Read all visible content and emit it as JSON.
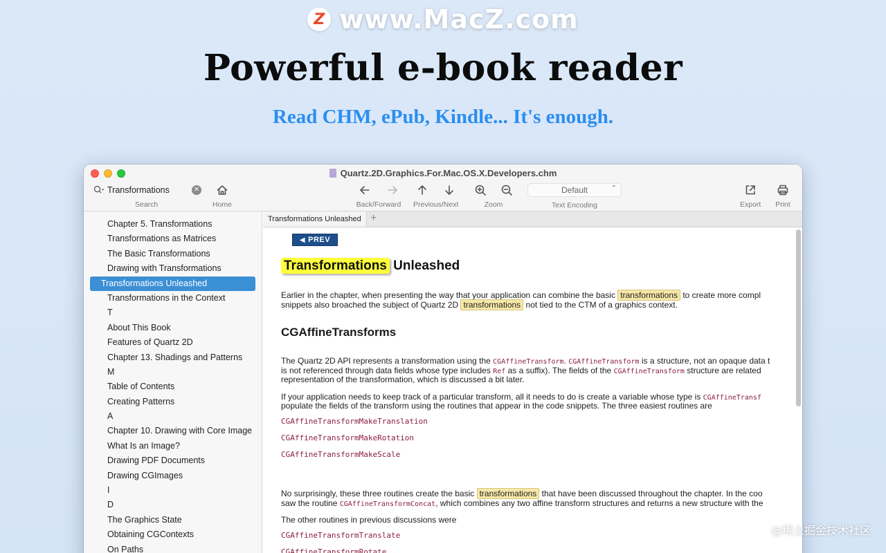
{
  "brand": {
    "logo_letter": "Z",
    "site": "www.MacZ.com"
  },
  "headline": "Powerful e-book reader",
  "subhead": "Read CHM, ePub, Kindle...  It's enough.",
  "window": {
    "title": "Quartz.2D.Graphics.For.Mac.OS.X.Developers.chm",
    "toolbar": {
      "search_value": "Transformations",
      "search_label": "Search",
      "home_label": "Home",
      "backforward_label": "Back/Forward",
      "prevnext_label": "Previous/Next",
      "zoom_label": "Zoom",
      "encoding_value": "Default",
      "encoding_label": "Text Encoding",
      "export_label": "Export",
      "print_label": "Print"
    },
    "sidebar_items": [
      "Chapter 5.  Transformations",
      "Transformations as Matrices",
      "The Basic Transformations",
      "Drawing with Transformations",
      "Transformations Unleashed",
      "Transformations in the Context",
      "T",
      "About This Book",
      "Features of Quartz 2D",
      "Chapter 13.  Shadings and Patterns",
      "M",
      "Table of Contents",
      "Creating Patterns",
      "A",
      "Chapter 10.  Drawing with Core Image",
      "What Is an Image?",
      "Drawing PDF Documents",
      "Drawing CGImages",
      "I",
      "D",
      "The Graphics State",
      "Obtaining CGContexts",
      "On Paths"
    ],
    "selected_index": 4,
    "tab": {
      "label": "Transformations Unleashed",
      "add": "+"
    },
    "content": {
      "prev_label": "PREV",
      "heading_highlight": "Transformations",
      "heading_rest": " Unleashed",
      "p1_a": "Earlier in the chapter, when presenting the way that your application can combine the basic ",
      "p1_hl": "transformations",
      "p1_b": " to create more compl",
      "p1_c": "snippets also broached the subject of Quartz 2D ",
      "p1_hl2": "transformations",
      "p1_d": " not tied to the CTM of a graphics context.",
      "h2": "CGAffineTransforms",
      "p2_a": "The Quartz 2D API represents a transformation using the ",
      "p2_code1": "CGAffineTransform",
      "p2_b": ". ",
      "p2_code2": "CGAffineTransform",
      "p2_c": " is a structure, not an opaque data t",
      "p2_d": "is not referenced through data fields whose type includes ",
      "p2_code3": "Ref",
      "p2_e": " as a suffix). The fields of the ",
      "p2_code4": "CGAffineTransform",
      "p2_f": " structure are related",
      "p2_g": "representation of the transformation, which is discussed a bit later.",
      "p3_a": "If your application needs to keep track of a particular transform, all it needs to do is create a variable whose type is ",
      "p3_code": "CGAffineTransf",
      "p3_b": "populate the fields of the transform using the routines that appear in the code snippets. The three easiest routines are",
      "code1": "CGAffineTransformMakeTranslation",
      "code2": "CGAffineTransformMakeRotation",
      "code3": "CGAffineTransformMakeScale",
      "p4_a": "No surprisingly, these three routines create the basic ",
      "p4_hl": "transformations",
      "p4_b": " that have been discussed throughout the chapter. In the coo",
      "p4_c": "saw the routine ",
      "p4_code": "CGAffineTransformConcat",
      "p4_d": ", which combines any two affine transform structures and returns a new structure with the",
      "p5": "The other routines in previous discussions were",
      "code4": "CGAffineTransformTranslate",
      "code5": "CGAffineTransformRotate"
    }
  },
  "watermark": "@稀土掘金技术社区",
  "colors": {
    "accent": "#3b8fd5",
    "subhead": "#2b8ef2",
    "highlight": "#ffff3c",
    "code": "#8a1f3d"
  }
}
